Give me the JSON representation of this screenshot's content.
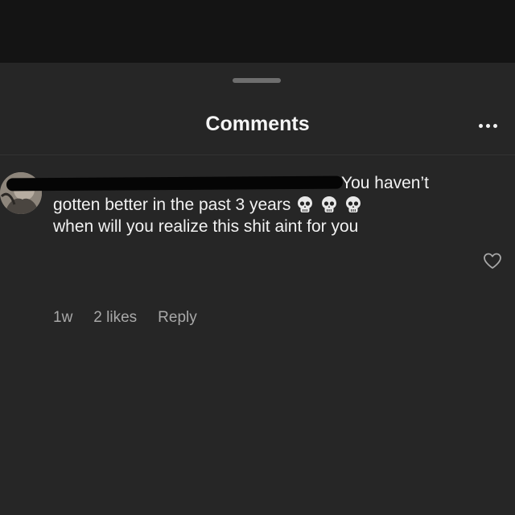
{
  "sheet": {
    "title": "Comments"
  },
  "comment": {
    "text_line1": "You haven’t",
    "text_line2": "gotten better in the past 3 years",
    "text_line3": "when will you realize this shit aint for you",
    "emoji": [
      "skull-icon",
      "skull-icon",
      "skull-icon"
    ],
    "time": "1w",
    "likes": "2 likes",
    "reply_label": "Reply"
  },
  "icons": {
    "more": "more-options-icon",
    "like": "heart-outline-icon"
  },
  "colors": {
    "background": "#262626",
    "backdrop": "#141414",
    "text_primary": "#f2f2f2",
    "text_secondary": "#a8a8a8"
  }
}
